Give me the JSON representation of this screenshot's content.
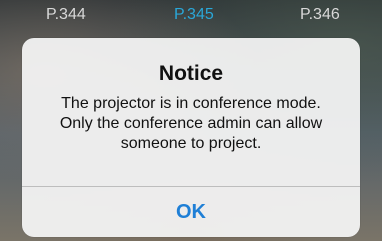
{
  "pager": {
    "labels": [
      "P.344",
      "P.345",
      "P.346"
    ],
    "active_label": "P.345",
    "active_color": "#2aa7d8"
  },
  "alert": {
    "title": "Notice",
    "message_lines": [
      "The projector is in conference mode.",
      "Only the conference admin can allow",
      "someone to project."
    ],
    "button_label": "OK",
    "button_color": "#1f7fd6"
  }
}
